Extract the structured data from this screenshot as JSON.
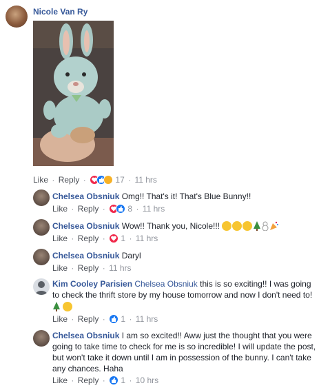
{
  "post": {
    "author": "Nicole Van Ry",
    "like_label": "Like",
    "reply_label": "Reply",
    "reaction_count": "17",
    "time": "11 hrs"
  },
  "comments": [
    {
      "author": "Chelsea Obsniuk",
      "text": "Omg!! That's it! That's Blue Bunny!!",
      "reaction_count": "8",
      "time": "11 hrs"
    },
    {
      "author": "Chelsea Obsniuk",
      "text": "Wow!! Thank you, Nicole!!!",
      "emojis": [
        "kissing-face",
        "heart-eyes-face",
        "grinning-face",
        "christmas-tree",
        "snowman",
        "party-popper"
      ],
      "reaction_count": "1",
      "time": "11 hrs"
    },
    {
      "author": "Chelsea Obsniuk",
      "text": "Daryl",
      "time": "11 hrs"
    },
    {
      "author": "Kim Cooley Parisien",
      "mention": "Chelsea Obsniuk",
      "text_line1": "this is so exciting!! I was going",
      "text_line2": "to check the thrift store by my house tomorrow and now I don't need to!",
      "emojis": [
        "christmas-tree",
        "smiling-face"
      ],
      "reaction_count": "1",
      "time": "11 hrs"
    },
    {
      "author": "Chelsea Obsniuk",
      "text_line1": "I am so excited!! Aww just the thought that you were",
      "text_line2": "going to take time to check for me is so incredible! I will update the post,",
      "text_line3": "but won't take it down until I am in possession of the bunny. I can't take",
      "text_line4": "any chances. Haha",
      "reaction_count": "1",
      "time": "10 hrs"
    }
  ],
  "labels": {
    "like": "Like",
    "reply": "Reply",
    "dot": "·"
  },
  "colors": {
    "link": "#365899",
    "meta": "#90949c",
    "like": "#1877f2",
    "love": "#f0284a"
  }
}
